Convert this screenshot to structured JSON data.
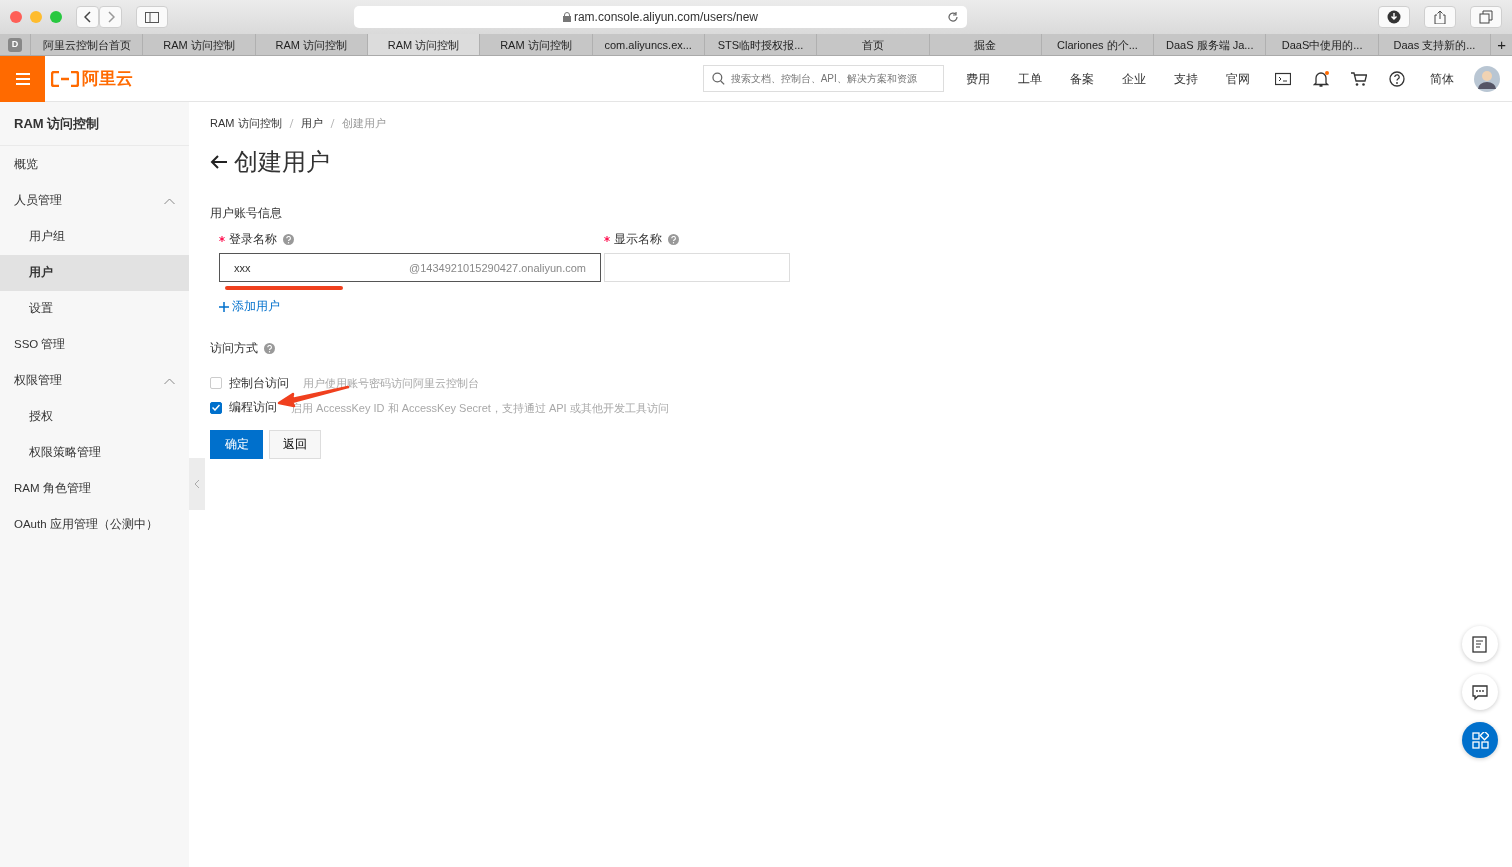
{
  "browser": {
    "url": "ram.console.aliyun.com/users/new",
    "tab_badge": "D",
    "tabs": [
      {
        "label": "阿里云控制台首页",
        "selected": false
      },
      {
        "label": "RAM 访问控制",
        "selected": false
      },
      {
        "label": "RAM 访问控制",
        "selected": false
      },
      {
        "label": "RAM 访问控制",
        "selected": true
      },
      {
        "label": "RAM 访问控制",
        "selected": false
      },
      {
        "label": "com.aliyuncs.ex...",
        "selected": false
      },
      {
        "label": "STS临时授权报...",
        "selected": false
      },
      {
        "label": "首页",
        "selected": false
      },
      {
        "label": "掘金",
        "selected": false
      },
      {
        "label": "Clariones 的个...",
        "selected": false
      },
      {
        "label": "DaaS 服务端 Ja...",
        "selected": false
      },
      {
        "label": "DaaS中使用的...",
        "selected": false
      },
      {
        "label": "Daas 支持新的...",
        "selected": false
      }
    ],
    "new_tab": "+"
  },
  "header": {
    "logo_text": "阿里云",
    "search_placeholder": "搜索文档、控制台、API、解决方案和资源",
    "nav": [
      "费用",
      "工单",
      "备案",
      "企业",
      "支持",
      "官网"
    ],
    "notification_dot": true,
    "language": "简体"
  },
  "sidebar": {
    "title": "RAM 访问控制",
    "items": [
      {
        "label": "概览",
        "selected": false
      },
      {
        "label": "人员管理",
        "selected": false,
        "expanded": true,
        "children": [
          {
            "label": "用户组",
            "selected": false
          },
          {
            "label": "用户",
            "selected": true
          },
          {
            "label": "设置",
            "selected": false
          }
        ]
      },
      {
        "label": "SSO 管理",
        "selected": false
      },
      {
        "label": "权限管理",
        "selected": false,
        "expanded": true,
        "children": [
          {
            "label": "授权",
            "selected": false
          },
          {
            "label": "权限策略管理",
            "selected": false
          }
        ]
      },
      {
        "label": "RAM 角色管理",
        "selected": false
      },
      {
        "label": "OAuth 应用管理（公测中）",
        "selected": false
      }
    ]
  },
  "breadcrumb": [
    "RAM 访问控制",
    "用户",
    "创建用户"
  ],
  "page_title": "创建用户",
  "form": {
    "section_title": "用户账号信息",
    "fields": [
      {
        "label": "登录名称",
        "required": true,
        "value": "xxx",
        "suffix": "@1434921015290427.onaliyun.com"
      },
      {
        "label": "显示名称",
        "required": true
      }
    ],
    "add_link": "添加用户",
    "access_title": "访问方式",
    "access_options": [
      {
        "label": "控制台访问",
        "checked": false,
        "description": "用户使用账号密码访问阿里云控制台"
      },
      {
        "label": "编程访问",
        "checked": true,
        "description": "启用 AccessKey ID 和 AccessKey Secret，支持通过 API 或其他开发工具访问"
      }
    ],
    "buttons": [
      {
        "label": "确定",
        "kind": "primary"
      },
      {
        "label": "返回",
        "kind": "secondary"
      }
    ]
  },
  "annotations": [
    {
      "kind": "underline",
      "color": "#f0401e"
    },
    {
      "kind": "arrow",
      "color": "#f0401e"
    }
  ]
}
